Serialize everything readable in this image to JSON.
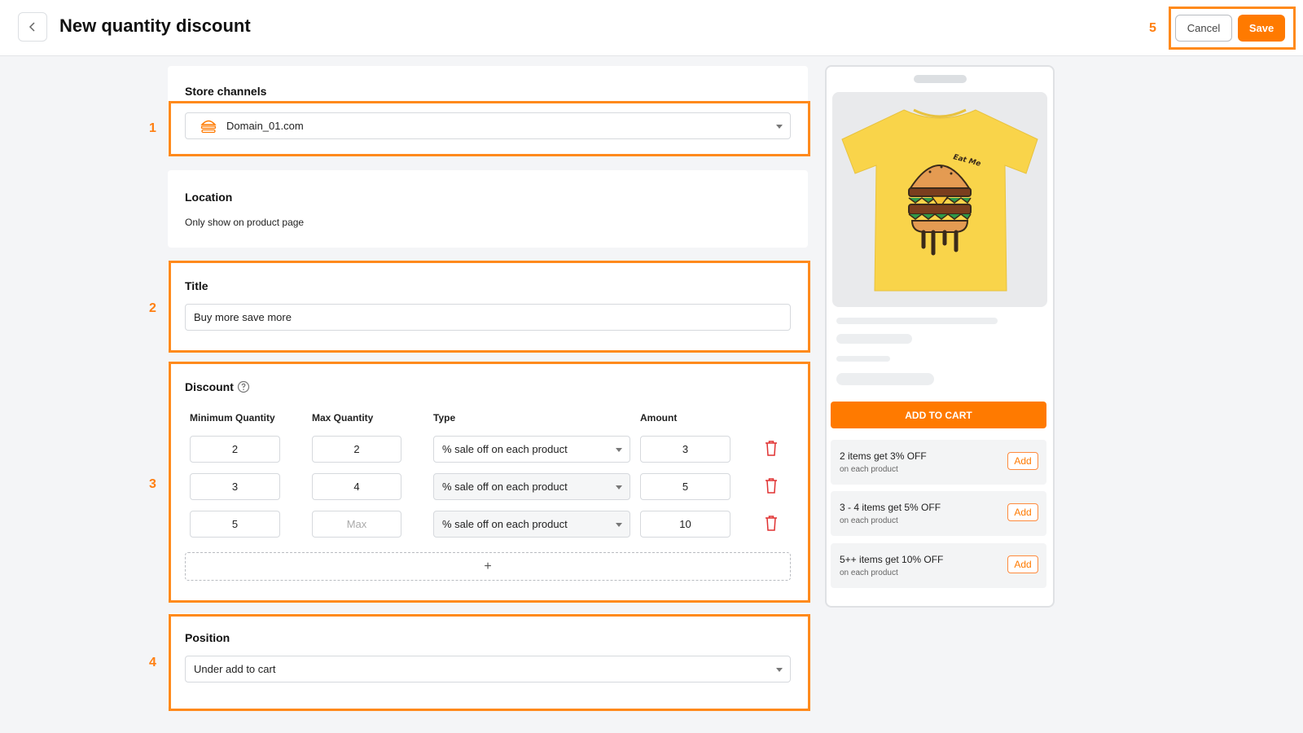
{
  "header": {
    "title": "New quantity discount",
    "cancel_label": "Cancel",
    "save_label": "Save"
  },
  "annotations": [
    "1",
    "2",
    "3",
    "4",
    "5"
  ],
  "store_channels": {
    "label": "Store channels",
    "selected": "Domain_01.com",
    "icon": "burger-icon"
  },
  "location": {
    "label": "Location",
    "value": "Only show on product page"
  },
  "title_section": {
    "label": "Title",
    "value": "Buy more save more"
  },
  "discount": {
    "label": "Discount",
    "columns": {
      "min": "Minimum Quantity",
      "max": "Max Quantity",
      "type": "Type",
      "amount": "Amount"
    },
    "rows": [
      {
        "min": "2",
        "max": "2",
        "max_placeholder": "",
        "type": "% sale off on each product",
        "amount": "3"
      },
      {
        "min": "3",
        "max": "4",
        "max_placeholder": "",
        "type": "% sale off on each product",
        "amount": "5"
      },
      {
        "min": "5",
        "max": "",
        "max_placeholder": "Max",
        "type": "% sale off on each product",
        "amount": "10"
      }
    ],
    "add_label": "+"
  },
  "position": {
    "label": "Position",
    "selected": "Under add to cart"
  },
  "preview": {
    "add_to_cart": "ADD TO CART",
    "offers": [
      {
        "title": "2 items get 3% OFF",
        "subtitle": "on each product",
        "button": "Add"
      },
      {
        "title": "3 - 4 items get 5% OFF",
        "subtitle": "on each product",
        "button": "Add"
      },
      {
        "title": "5++ items get 10% OFF",
        "subtitle": "on each product",
        "button": "Add"
      }
    ],
    "product_print": "Eat Me"
  },
  "colors": {
    "accent": "#ff7a00",
    "highlight": "#ff8a1c",
    "shirt": "#f9d44a",
    "delete": "#e03131"
  }
}
